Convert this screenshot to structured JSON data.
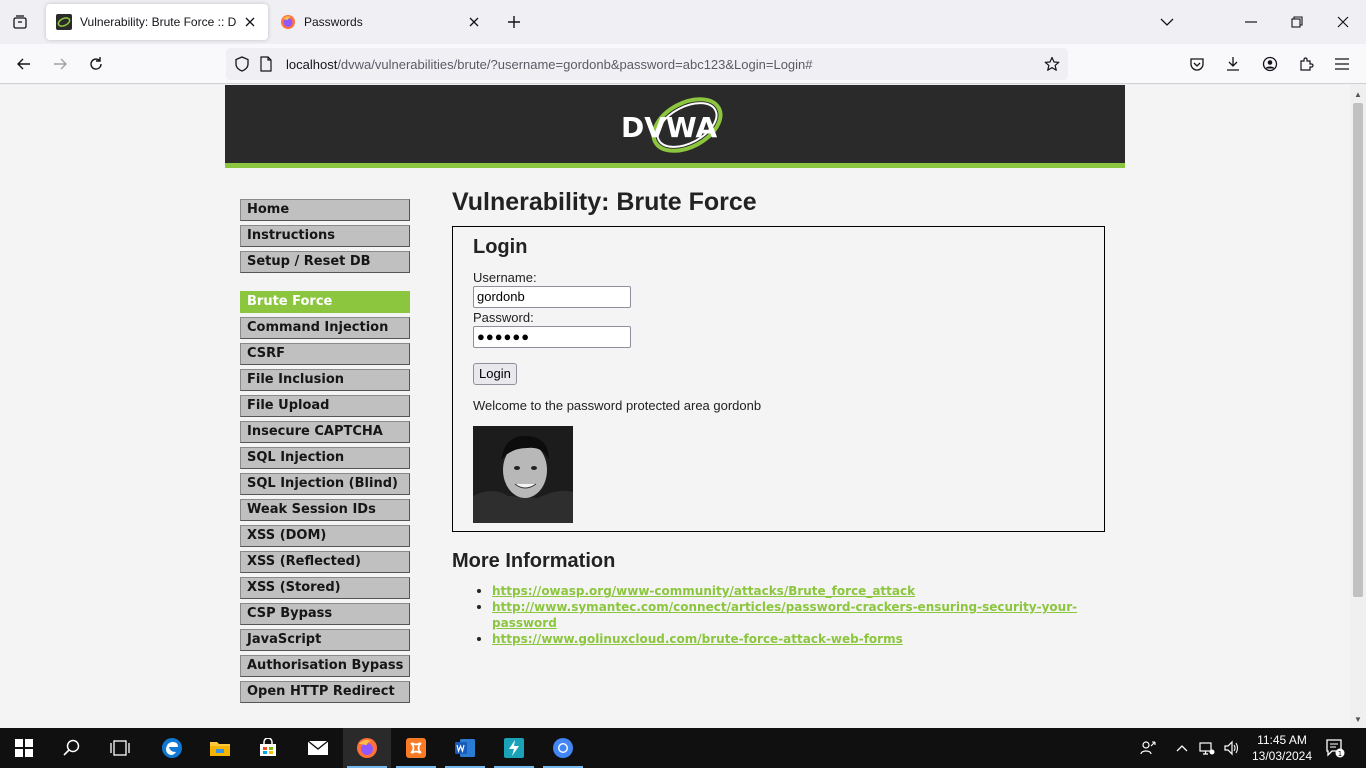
{
  "browser": {
    "tabs": [
      {
        "title": "Vulnerability: Brute Force :: Damn Vulnerable Web Application (DVWA)",
        "active": true
      },
      {
        "title": "Passwords",
        "active": false
      }
    ],
    "url": {
      "host": "localhost",
      "path": "/dvwa/vulnerabilities/brute/?username=gordonb&password=abc123&Login=Login#"
    }
  },
  "dvwa": {
    "logo_text": "DVWA",
    "menu": {
      "group1": [
        "Home",
        "Instructions",
        "Setup / Reset DB"
      ],
      "group2": [
        "Brute Force",
        "Command Injection",
        "CSRF",
        "File Inclusion",
        "File Upload",
        "Insecure CAPTCHA",
        "SQL Injection",
        "SQL Injection (Blind)",
        "Weak Session IDs",
        "XSS (DOM)",
        "XSS (Reflected)",
        "XSS (Stored)",
        "CSP Bypass",
        "JavaScript",
        "Authorisation Bypass",
        "Open HTTP Redirect"
      ],
      "selected": "Brute Force"
    },
    "page_title": "Vulnerability: Brute Force",
    "login": {
      "heading": "Login",
      "username_label": "Username:",
      "username_value": "gordonb",
      "password_label": "Password:",
      "password_mask": "●●●●●●",
      "button_label": "Login",
      "welcome": "Welcome to the password protected area gordonb"
    },
    "more_info": {
      "heading": "More Information",
      "links": [
        "https://owasp.org/www-community/attacks/Brute_force_attack",
        "http://www.symantec.com/connect/articles/password-crackers-ensuring-security-your-password",
        "https://www.golinuxcloud.com/brute-force-attack-web-forms"
      ]
    }
  },
  "taskbar": {
    "time": "11:45 AM",
    "date": "13/03/2024",
    "notification_count": "1"
  },
  "colors": {
    "dvwa_green": "#8cc63e",
    "header_dark": "#2a2a2a"
  }
}
